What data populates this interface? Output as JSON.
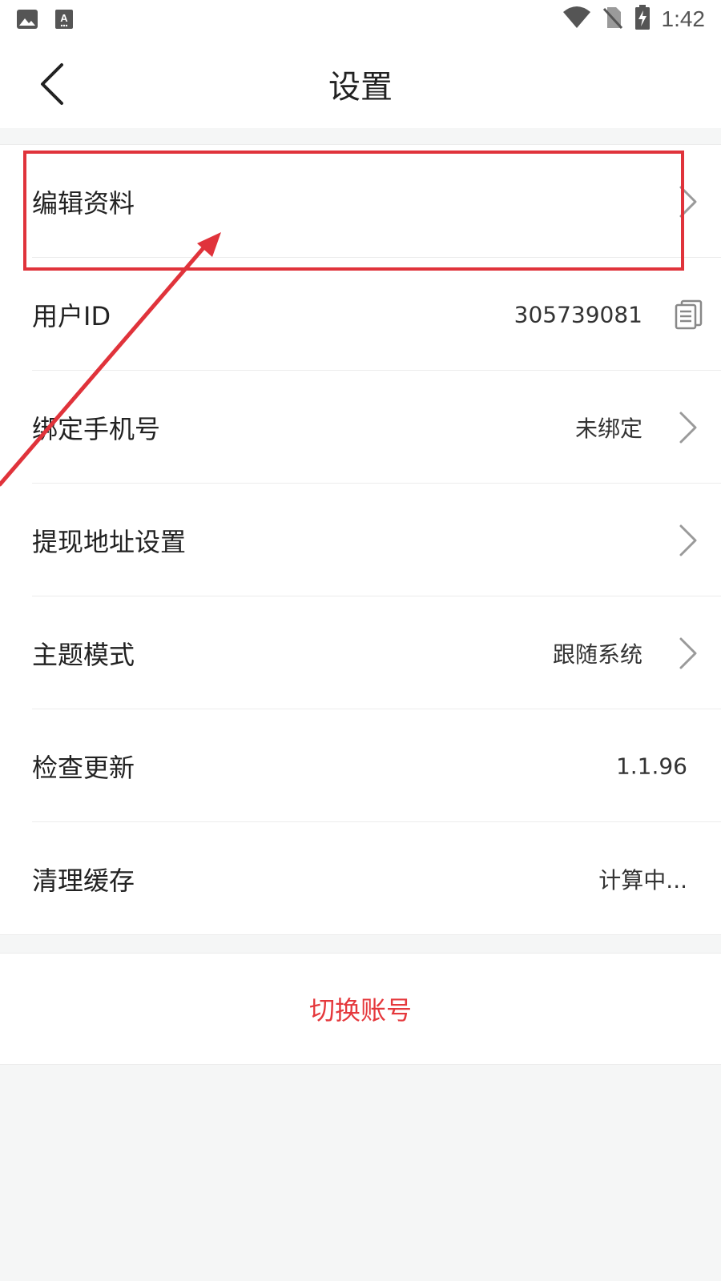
{
  "status_bar": {
    "time": "1:42",
    "left_icons": [
      "image-icon",
      "keyboard-a-icon"
    ],
    "right_icons": [
      "wifi-icon",
      "no-sim-icon",
      "battery-charging-icon"
    ]
  },
  "header": {
    "title": "设置",
    "back_icon": "chevron-left-icon"
  },
  "settings": {
    "items": [
      {
        "label": "编辑资料",
        "value": "",
        "has_arrow": true
      },
      {
        "label": "用户ID",
        "value": "305739081",
        "has_copy": true
      },
      {
        "label": "绑定手机号",
        "value": "未绑定",
        "has_arrow": true
      },
      {
        "label": "提现地址设置",
        "value": "",
        "has_arrow": true
      },
      {
        "label": "主题模式",
        "value": "跟随系统",
        "has_arrow": true
      },
      {
        "label": "检查更新",
        "value": "1.1.96",
        "has_arrow": false
      },
      {
        "label": "清理缓存",
        "value": "计算中...",
        "has_arrow": false
      }
    ]
  },
  "switch_account": {
    "label": "切换账号"
  },
  "colors": {
    "accent_red": "#e5383c",
    "annotation_red": "#e0333b",
    "background": "#f5f6f6",
    "row_background": "#ffffff"
  }
}
